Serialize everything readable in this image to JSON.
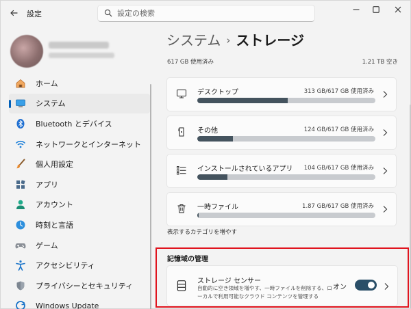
{
  "window": {
    "title": "設定",
    "search_placeholder": "設定の検索"
  },
  "sidebar": {
    "items": [
      {
        "label": "ホーム",
        "icon": "home-icon",
        "selected": false
      },
      {
        "label": "システム",
        "icon": "system-monitor-icon",
        "selected": true
      },
      {
        "label": "Bluetooth とデバイス",
        "icon": "bluetooth-icon",
        "selected": false
      },
      {
        "label": "ネットワークとインターネット",
        "icon": "wifi-icon",
        "selected": false
      },
      {
        "label": "個人用設定",
        "icon": "paintbrush-icon",
        "selected": false
      },
      {
        "label": "アプリ",
        "icon": "apps-icon",
        "selected": false
      },
      {
        "label": "アカウント",
        "icon": "account-icon",
        "selected": false
      },
      {
        "label": "時刻と言語",
        "icon": "time-language-icon",
        "selected": false
      },
      {
        "label": "ゲーム",
        "icon": "gamepad-icon",
        "selected": false
      },
      {
        "label": "アクセシビリティ",
        "icon": "accessibility-icon",
        "selected": false
      },
      {
        "label": "プライバシーとセキュリティ",
        "icon": "shield-icon",
        "selected": false
      },
      {
        "label": "Windows Update",
        "icon": "windows-update-icon",
        "selected": false
      }
    ]
  },
  "main": {
    "breadcrumb_parent": "システム",
    "breadcrumb_separator": "›",
    "breadcrumb_current": "ストレージ",
    "used_total": "617 GB 使用済み",
    "capacity": "1.21 TB 空き",
    "categories": [
      {
        "title": "デスクトップ",
        "size": "313 GB/617 GB 使用済み",
        "fraction": 0.507,
        "icon": "desktop-icon"
      },
      {
        "title": "その他",
        "size": "124 GB/617 GB 使用済み",
        "fraction": 0.201,
        "icon": "other-files-icon"
      },
      {
        "title": "インストールされているアプリ",
        "size": "104 GB/617 GB 使用済み",
        "fraction": 0.169,
        "icon": "installed-apps-icon"
      },
      {
        "title": "一時ファイル",
        "size": "1.87 GB/617 GB 使用済み",
        "fraction": 0.003,
        "icon": "trash-icon"
      }
    ],
    "more_categories_link": "表示するカテゴリを増やす",
    "management_title": "記憶域の管理",
    "storage_sense": {
      "title": "ストレージ センサー",
      "description": "自動的に空き領域を増やす、一時ファイルを削除する、ローカルで利用可能なクラウド コンテンツを管理する",
      "toggle_label": "オン",
      "toggle_on": true
    }
  },
  "colors": {
    "accent": "#005fb8",
    "bar_fill": "#44535e",
    "bar_track": "#c8cbcf",
    "highlight_border": "#e0141e"
  }
}
